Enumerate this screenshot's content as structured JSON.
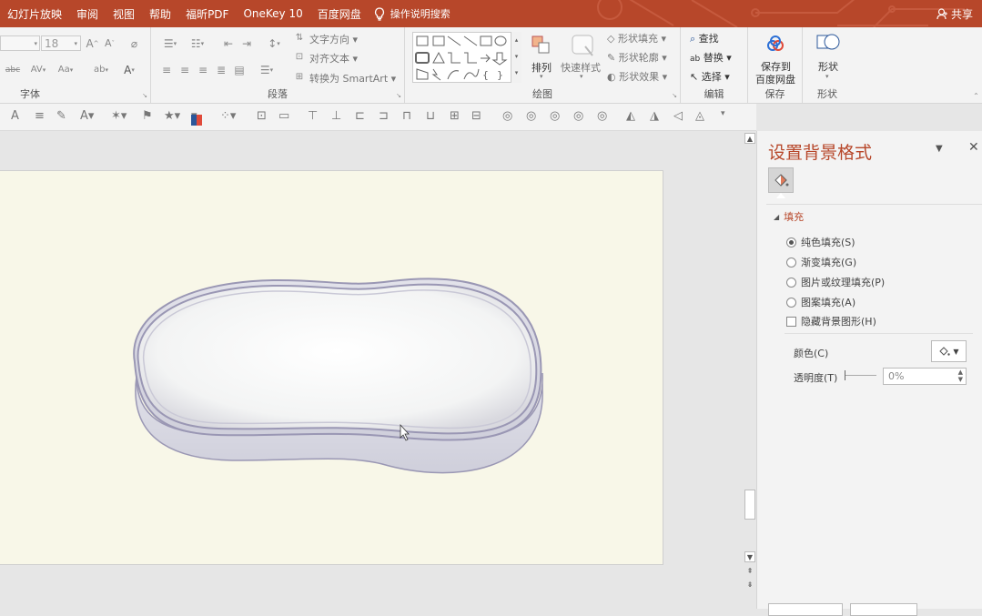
{
  "title_bar": {
    "tabs": [
      "幻灯片放映",
      "审阅",
      "视图",
      "帮助",
      "福昕PDF",
      "OneKey 10",
      "百度网盘"
    ],
    "search_text": "操作说明搜索",
    "share_label": "共享",
    "colors": {
      "accent": "#b7472a"
    }
  },
  "ribbon": {
    "font": {
      "label": "字体",
      "size_value": "18",
      "grow_label": "A",
      "shrink_label": "A",
      "strike_label": "abc",
      "spacing_label": "AV",
      "case_label": "Aa",
      "color_label": "A"
    },
    "paragraph": {
      "label": "段落",
      "text_direction": "文字方向",
      "align_text": "对齐文本",
      "smartart": "转换为 SmartArt"
    },
    "drawing": {
      "label": "绘图",
      "arrange": "排列",
      "quick_styles": "快速样式",
      "shape_fill": "形状填充",
      "shape_outline": "形状轮廓",
      "shape_effects": "形状效果"
    },
    "editing": {
      "label": "编辑",
      "find": "查找",
      "replace": "替换",
      "select": "选择"
    },
    "save": {
      "label": "保存",
      "save_to_line1": "保存到",
      "save_to_line2": "百度网盘"
    },
    "shape": {
      "label": "形状",
      "button": "形状"
    }
  },
  "format_pane": {
    "title": "设置背景格式",
    "section_fill": "填充",
    "options": [
      {
        "label": "纯色填充(S)",
        "selected": true
      },
      {
        "label": "渐变填充(G)",
        "selected": false
      },
      {
        "label": "图片或纹理填充(P)",
        "selected": false
      },
      {
        "label": "图案填充(A)",
        "selected": false
      }
    ],
    "hide_bg": {
      "label": "隐藏背景图形(H)",
      "checked": false
    },
    "color_label": "颜色(C)",
    "transparency_label": "透明度(T)",
    "transparency_value": "0%"
  },
  "slide": {
    "background_color": "#f8f7e8",
    "shape_fill": "#f5f6f6",
    "shape_outline": "#9a97b4"
  }
}
